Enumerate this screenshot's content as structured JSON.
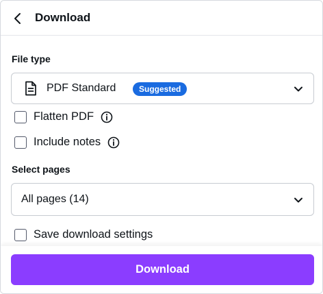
{
  "header": {
    "title": "Download",
    "back_icon": "chevron-left-icon"
  },
  "file_type": {
    "section_label": "File type",
    "selected": "PDF Standard",
    "selected_icon": "document-icon",
    "badge": "Suggested",
    "badge_color": "#1a6be0"
  },
  "options": {
    "flatten_pdf": {
      "label": "Flatten PDF",
      "checked": false
    },
    "include_notes": {
      "label": "Include notes",
      "checked": false
    }
  },
  "pages": {
    "section_label": "Select pages",
    "selected": "All pages (14)"
  },
  "save_settings": {
    "label": "Save download settings",
    "checked": false
  },
  "footer": {
    "download_label": "Download",
    "accent_color": "#8b3dff"
  }
}
